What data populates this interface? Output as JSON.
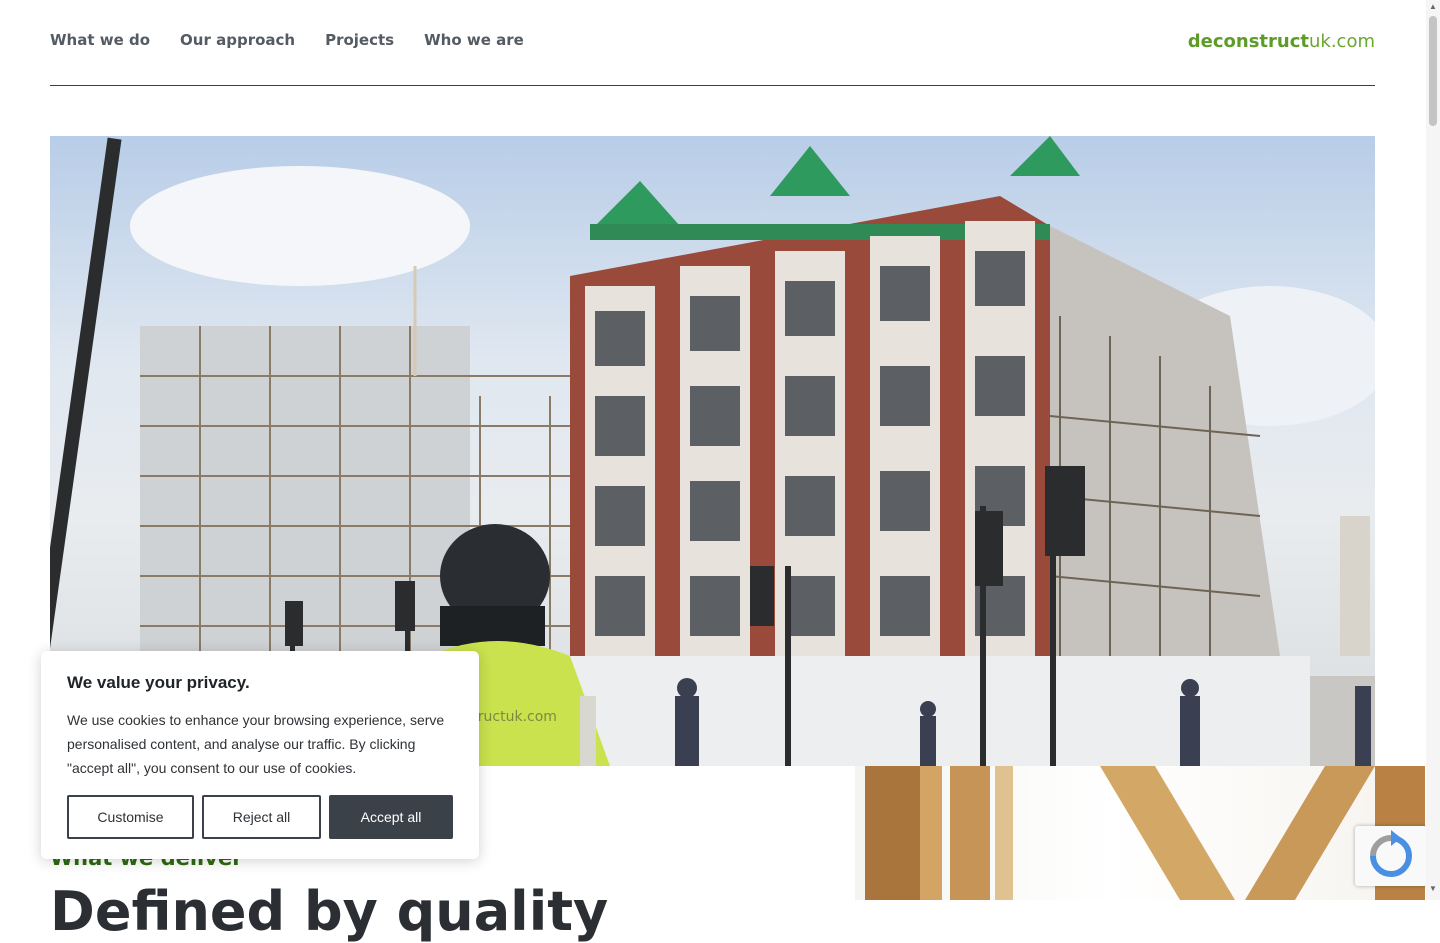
{
  "nav": {
    "items": [
      {
        "label": "What we do"
      },
      {
        "label": "Our approach"
      },
      {
        "label": "Projects"
      },
      {
        "label": "Who we are"
      }
    ],
    "logo_bold": "deconstruct",
    "logo_light": "uk.com"
  },
  "hero": {
    "image": "construction-scaffolding-photo",
    "vest_text": "structuk.com"
  },
  "section": {
    "kicker": "What we deliver",
    "title": "Defined by quality"
  },
  "cookie": {
    "title": "We value your privacy.",
    "text": "We use cookies to enhance your browsing experience, serve personalised content, and analyse our traffic. By clicking \"accept all\", you consent to our use of cookies.",
    "customise_label": "Customise",
    "reject_label": "Reject all",
    "accept_label": "Accept all"
  },
  "recaptcha": {
    "icon": "recaptcha-icon"
  },
  "colors": {
    "brand_green": "#5d9c28",
    "kicker_green": "#2d6a10",
    "dark_button": "#3b4149"
  }
}
